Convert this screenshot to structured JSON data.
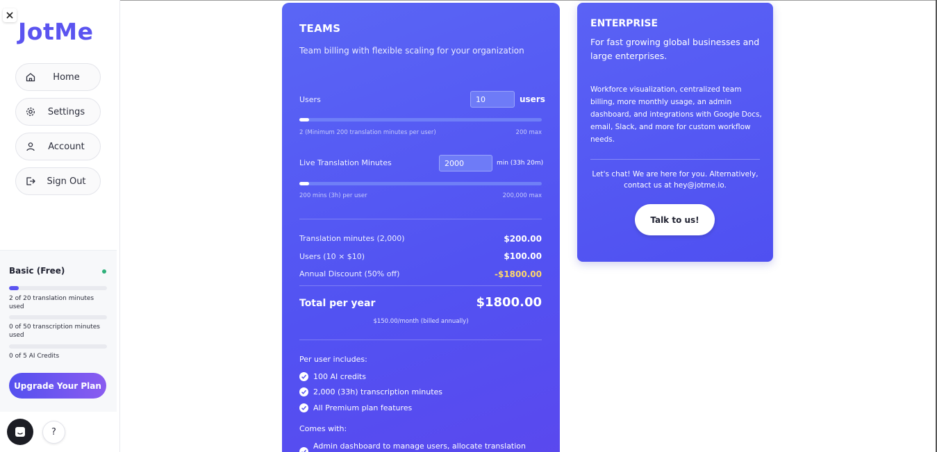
{
  "sidebar": {
    "logo": "JotMe",
    "nav": [
      {
        "label": "Home",
        "icon": "home-icon"
      },
      {
        "label": "Settings",
        "icon": "gear-icon"
      },
      {
        "label": "Account",
        "icon": "user-icon"
      },
      {
        "label": "Sign Out",
        "icon": "sign-out-icon"
      }
    ],
    "plan": {
      "title": "Basic (Free)",
      "usage": [
        {
          "text": "2 of 20 translation minutes used",
          "fraction": 0.1
        },
        {
          "text": "0 of 50 transcription minutes used",
          "fraction": 0
        },
        {
          "text": "0 of 5 AI Credits",
          "fraction": 0
        }
      ],
      "upgrade_label": "Upgrade Your Plan"
    },
    "help_label": "?"
  },
  "teams": {
    "title": "TEAMS",
    "subtitle": "Team billing with flexible scaling for your organization",
    "users": {
      "label": "Users",
      "value": "10",
      "unit": "users",
      "min_text": "2 (Minimum 200 translation minutes per user)",
      "max_text": "200 max",
      "fraction": 0.04
    },
    "minutes": {
      "label": "Live Translation Minutes",
      "value": "2000",
      "unit": "min (33h 20m)",
      "min_text": "200 mins (3h) per user",
      "max_text": "200,000 max",
      "fraction": 0.01
    },
    "breakdown": [
      {
        "label": "Translation minutes (2,000)",
        "value": "$200.00"
      },
      {
        "label": "Users (10 × $10)",
        "value": "$100.00"
      },
      {
        "label": "Annual Discount (50% off)",
        "value": "-$1800.00"
      }
    ],
    "total_label": "Total per year",
    "total_value": "$1800.00",
    "monthly_note": "$150.00/month (billed annually)",
    "per_user_heading": "Per user includes:",
    "per_user_features": [
      "100 AI credits",
      "2,000 (33h) transcription minutes",
      "All Premium plan features"
    ],
    "comes_with_heading": "Comes with:",
    "comes_with_features": [
      "Admin dashboard to manage users, allocate translation"
    ]
  },
  "enterprise": {
    "title": "ENTERPRISE",
    "subtitle": "For fast growing global businesses and large enterprises.",
    "description": "Workforce visualization, centralized team billing, more monthly usage, an admin dashboard, and integrations with Google Docs, email, Slack, and more for custom workflow needs.",
    "chat_text": "Let's chat! We are here for you. Alternatively, contact us at hey@jotme.io.",
    "button_label": "Talk to us!"
  },
  "colors": {
    "accent": "#5b54f0",
    "discount": "#ffd86b",
    "status_ok": "#2fb07a"
  }
}
